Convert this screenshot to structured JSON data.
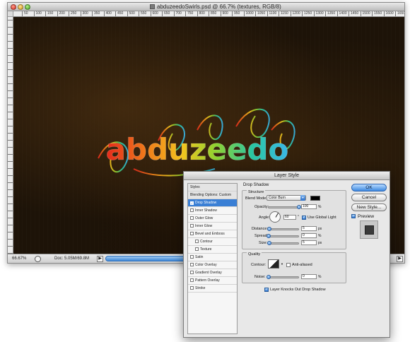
{
  "document": {
    "title": "abduzeedoSwirls.psd @ 66.7% (textures, RGB/8)",
    "ruler_ticks": [
      "50",
      "100",
      "150",
      "200",
      "250",
      "300",
      "350",
      "400",
      "450",
      "500",
      "550",
      "600",
      "650",
      "700",
      "750",
      "800",
      "850",
      "900",
      "950",
      "1000",
      "1050",
      "1100",
      "1150",
      "1200",
      "1250",
      "1300",
      "1350",
      "1400",
      "1450",
      "1500",
      "1550",
      "1600",
      "1650"
    ],
    "artwork_text": "abduzeedo",
    "status": {
      "zoom": "66.67%",
      "doc_info": "Doc: 5.05M/69.8M"
    }
  },
  "dialog": {
    "title": "Layer Style",
    "styles_list": [
      {
        "label": "Styles",
        "checkbox": false,
        "checked": false,
        "selected": false,
        "indent": false,
        "header": true
      },
      {
        "label": "Blending Options: Custom",
        "checkbox": false,
        "checked": false,
        "selected": false,
        "indent": false,
        "header": true
      },
      {
        "label": "Drop Shadow",
        "checkbox": true,
        "checked": true,
        "selected": true,
        "indent": false,
        "header": false
      },
      {
        "label": "Inner Shadow",
        "checkbox": true,
        "checked": false,
        "selected": false,
        "indent": false,
        "header": false
      },
      {
        "label": "Outer Glow",
        "checkbox": true,
        "checked": false,
        "selected": false,
        "indent": false,
        "header": false
      },
      {
        "label": "Inner Glow",
        "checkbox": true,
        "checked": false,
        "selected": false,
        "indent": false,
        "header": false
      },
      {
        "label": "Bevel and Emboss",
        "checkbox": true,
        "checked": false,
        "selected": false,
        "indent": false,
        "header": false
      },
      {
        "label": "Contour",
        "checkbox": true,
        "checked": false,
        "selected": false,
        "indent": true,
        "header": false
      },
      {
        "label": "Texture",
        "checkbox": true,
        "checked": false,
        "selected": false,
        "indent": true,
        "header": false
      },
      {
        "label": "Satin",
        "checkbox": true,
        "checked": false,
        "selected": false,
        "indent": false,
        "header": false
      },
      {
        "label": "Color Overlay",
        "checkbox": true,
        "checked": false,
        "selected": false,
        "indent": false,
        "header": false
      },
      {
        "label": "Gradient Overlay",
        "checkbox": true,
        "checked": false,
        "selected": false,
        "indent": false,
        "header": false
      },
      {
        "label": "Pattern Overlay",
        "checkbox": true,
        "checked": false,
        "selected": false,
        "indent": false,
        "header": false
      },
      {
        "label": "Stroke",
        "checkbox": true,
        "checked": false,
        "selected": false,
        "indent": false,
        "header": false
      }
    ],
    "panel_title": "Drop Shadow",
    "structure": {
      "group_label": "Structure",
      "blend_mode_label": "Blend Mode:",
      "blend_mode_value": "Color Burn",
      "shadow_color": "#000000",
      "opacity_label": "Opacity:",
      "opacity_value": "100",
      "opacity_unit": "%",
      "opacity_level": 1.0,
      "angle_label": "Angle:",
      "angle_value": "60",
      "angle_unit": "°",
      "global_light_label": "Use Global Light",
      "global_light_checked": true,
      "distance_label": "Distance:",
      "distance_value": "5",
      "distance_unit": "px",
      "spread_label": "Spread:",
      "spread_value": "0",
      "spread_unit": "%",
      "size_label": "Size:",
      "size_value": "5",
      "size_unit": "px"
    },
    "quality": {
      "group_label": "Quality",
      "contour_label": "Contour:",
      "anti_aliased_label": "Anti-aliased",
      "anti_aliased_checked": false,
      "noise_label": "Noise:",
      "noise_value": "0",
      "noise_unit": "%"
    },
    "knockout_label": "Layer Knocks Out Drop Shadow",
    "knockout_checked": true,
    "buttons": {
      "ok": "OK",
      "cancel": "Cancel",
      "new_style": "New Style..."
    },
    "preview_label": "Preview",
    "preview_checked": true
  }
}
